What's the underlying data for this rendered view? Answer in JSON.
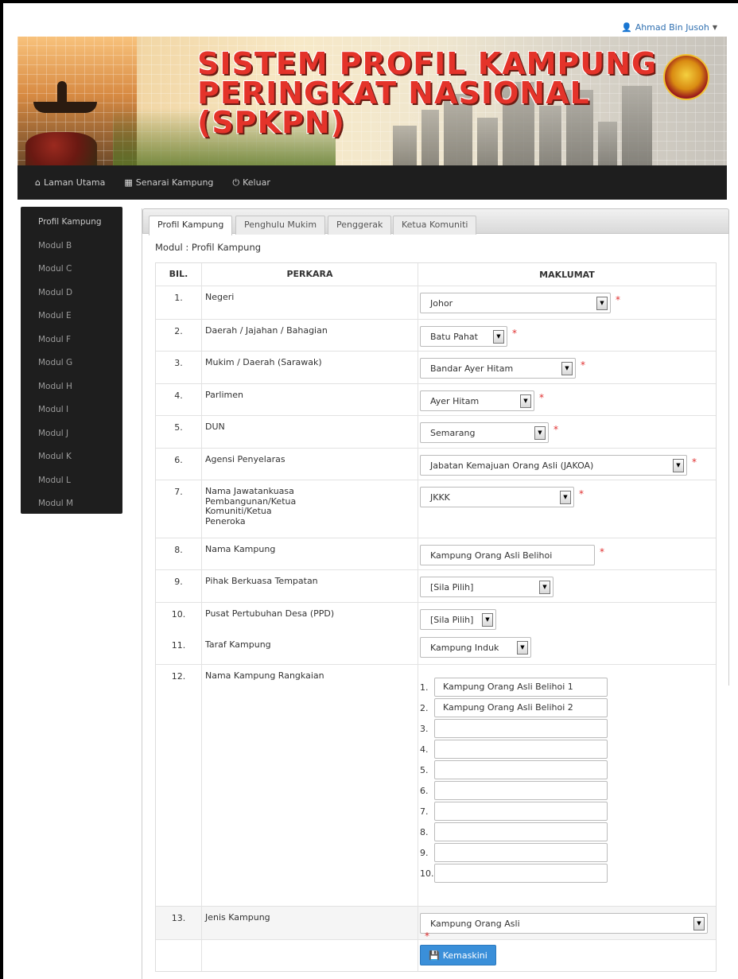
{
  "user": {
    "name": "Ahmad Bin Jusoh"
  },
  "banner": {
    "title_lines": [
      "SISTEM PROFIL KAMPUNG",
      "PERINGKAT NASIONAL",
      "(SPKPN)"
    ]
  },
  "topnav": [
    {
      "label": "Laman Utama",
      "icon": "home-icon"
    },
    {
      "label": "Senarai Kampung",
      "icon": "grid-icon"
    },
    {
      "label": "Keluar",
      "icon": "power-icon"
    }
  ],
  "sidebar": [
    "Profil Kampung",
    "Modul B",
    "Modul C",
    "Modul D",
    "Modul E",
    "Modul F",
    "Modul G",
    "Modul H",
    "Modul I",
    "Modul J",
    "Modul K",
    "Modul L",
    "Modul M"
  ],
  "tabs": [
    "Profil Kampung",
    "Penghulu Mukim",
    "Penggerak",
    "Ketua Komuniti"
  ],
  "modul_label": "Modul : Profil Kampung",
  "table": {
    "headers": {
      "bil": "BIL.",
      "perkara": "PERKARA",
      "maklumat": "MAKLUMAT"
    },
    "rows": [
      {
        "bil": "1.",
        "perkara": "Negeri",
        "value": "Johor"
      },
      {
        "bil": "2.",
        "perkara": "Daerah / Jajahan / Bahagian",
        "value": "Batu Pahat"
      },
      {
        "bil": "3.",
        "perkara": "Mukim / Daerah (Sarawak)",
        "value": "Bandar Ayer Hitam"
      },
      {
        "bil": "4.",
        "perkara": "Parlimen",
        "value": "Ayer Hitam"
      },
      {
        "bil": "5.",
        "perkara": "DUN",
        "value": "Semarang"
      },
      {
        "bil": "6.",
        "perkara": "Agensi Penyelaras",
        "value": "Jabatan Kemajuan Orang Asli (JAKOA)"
      },
      {
        "bil": "7.",
        "perkara": "Nama Jawatankuasa Pembangunan/Ketua Komuniti/Ketua Peneroka",
        "value": "JKKK"
      },
      {
        "bil": "8.",
        "perkara": "Nama Kampung",
        "value": "Kampung Orang Asli Belihoi"
      },
      {
        "bil": "9.",
        "perkara": "Pihak Berkuasa Tempatan",
        "value": "[Sila Pilih]"
      },
      {
        "bil": "10.",
        "perkara": "Pusat Pertubuhan Desa (PPD)",
        "value": "[Sila Pilih]"
      },
      {
        "bil": "11.",
        "perkara": "Taraf Kampung",
        "value": "Kampung Induk"
      },
      {
        "bil": "12.",
        "perkara": "Nama Kampung Rangkaian",
        "value": ""
      },
      {
        "bil": "13.",
        "perkara": "Jenis Kampung",
        "value": "Kampung Orang Asli"
      }
    ],
    "rangkaian": [
      {
        "num": "1.",
        "value": "Kampung Orang Asli Belihoi 1"
      },
      {
        "num": "2.",
        "value": "Kampung Orang Asli Belihoi 2"
      },
      {
        "num": "3.",
        "value": ""
      },
      {
        "num": "4.",
        "value": ""
      },
      {
        "num": "5.",
        "value": ""
      },
      {
        "num": "6.",
        "value": ""
      },
      {
        "num": "7.",
        "value": ""
      },
      {
        "num": "8.",
        "value": ""
      },
      {
        "num": "9.",
        "value": ""
      },
      {
        "num": "10.",
        "value": ""
      }
    ],
    "submit_label": "Kemaskini"
  },
  "required_mark": "*",
  "colors": {
    "nav_bg": "#1e1e1e",
    "primary": "#3a8fd9",
    "required": "#e03030",
    "banner_title": "#e4332a"
  }
}
